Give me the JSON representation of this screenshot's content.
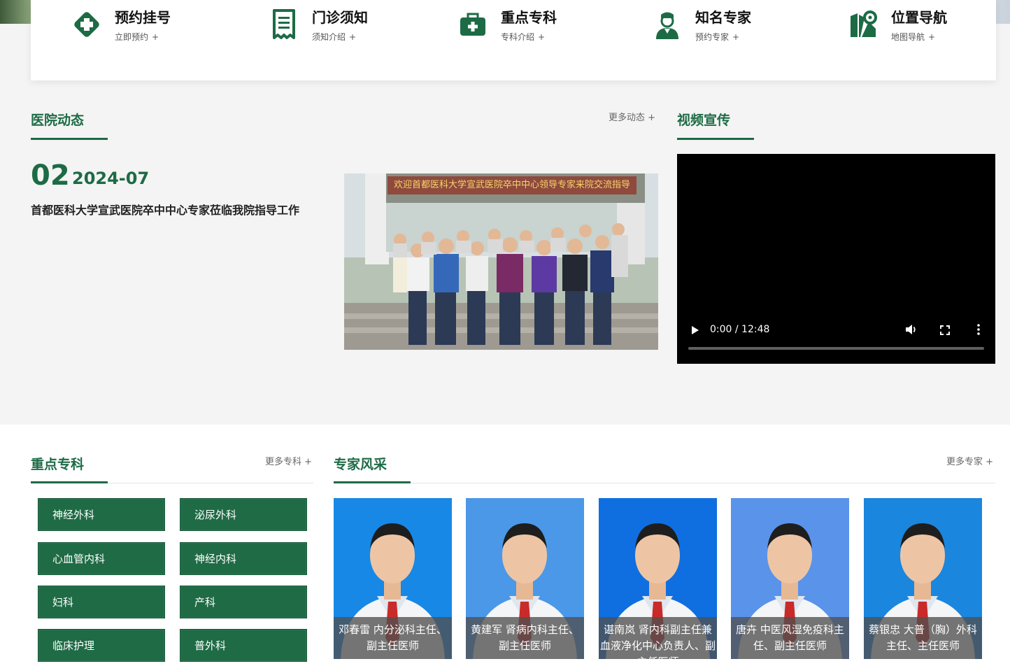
{
  "quick_links": [
    {
      "title": "预约挂号",
      "sub": "立即预约",
      "icon": "medical-cross-diamond-icon"
    },
    {
      "title": "门诊须知",
      "sub": "须知介绍",
      "icon": "receipt-list-icon"
    },
    {
      "title": "重点专科",
      "sub": "专科介绍",
      "icon": "medical-kit-icon"
    },
    {
      "title": "知名专家",
      "sub": "预约专家",
      "icon": "doctor-icon"
    },
    {
      "title": "位置导航",
      "sub": "地图导航",
      "icon": "map-pin-icon"
    }
  ],
  "plus": "+",
  "news": {
    "title": "医院动态",
    "more": "更多动态",
    "day": "02",
    "year_month": "2024-07",
    "headline": "首都医科大学宣武医院卒中中心专家莅临我院指导工作",
    "banner_text": "欢迎首都医科大学宣武医院卒中中心领导专家来院交流指导"
  },
  "video": {
    "title": "视频宣传",
    "time": "0:00 / 12:48"
  },
  "departments": {
    "title": "重点专科",
    "more": "更多专科",
    "items": [
      "神经外科",
      "泌尿外科",
      "心血管内科",
      "神经内科",
      "妇科",
      "产科",
      "临床护理",
      "普外科"
    ]
  },
  "experts": {
    "title": "专家风采",
    "more": "更多专家",
    "items": [
      {
        "caption": "邓春雷 内分泌科主任、副主任医师",
        "bg": "#1788e6"
      },
      {
        "caption": "黄建军 肾病内科主任、副主任医师",
        "bg": "#4b98e8"
      },
      {
        "caption": "谌南岚 肾内科副主任兼血液净化中心负责人、副主任医师",
        "bg": "#0f6fe0"
      },
      {
        "caption": "唐卉 中医风湿免疫科主任、副主任医师",
        "bg": "#5a93ea"
      },
      {
        "caption": "蔡银忠 大普（胸）外科主任、主任医师",
        "bg": "#1b86dd"
      }
    ]
  },
  "colors": {
    "brand_green": "#1d6b45",
    "button_green": "#1e6b45"
  }
}
